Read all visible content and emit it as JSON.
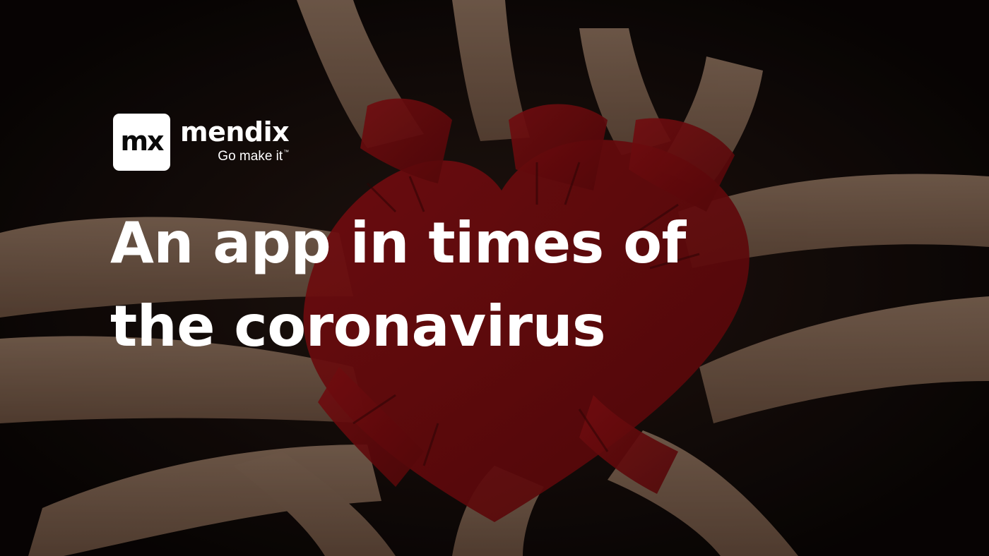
{
  "brand": {
    "logo_mark": "mx",
    "name": "mendix",
    "tagline": "Go make it",
    "tagline_mark": "™"
  },
  "headline": {
    "line1": "An app in times of",
    "line2": "the coronavirus"
  },
  "background": {
    "icon": "painted-hands-heart-photo",
    "base_color": "#0b0706",
    "skin_color": "#9a7a62",
    "paint_color": "#8c0d10"
  }
}
